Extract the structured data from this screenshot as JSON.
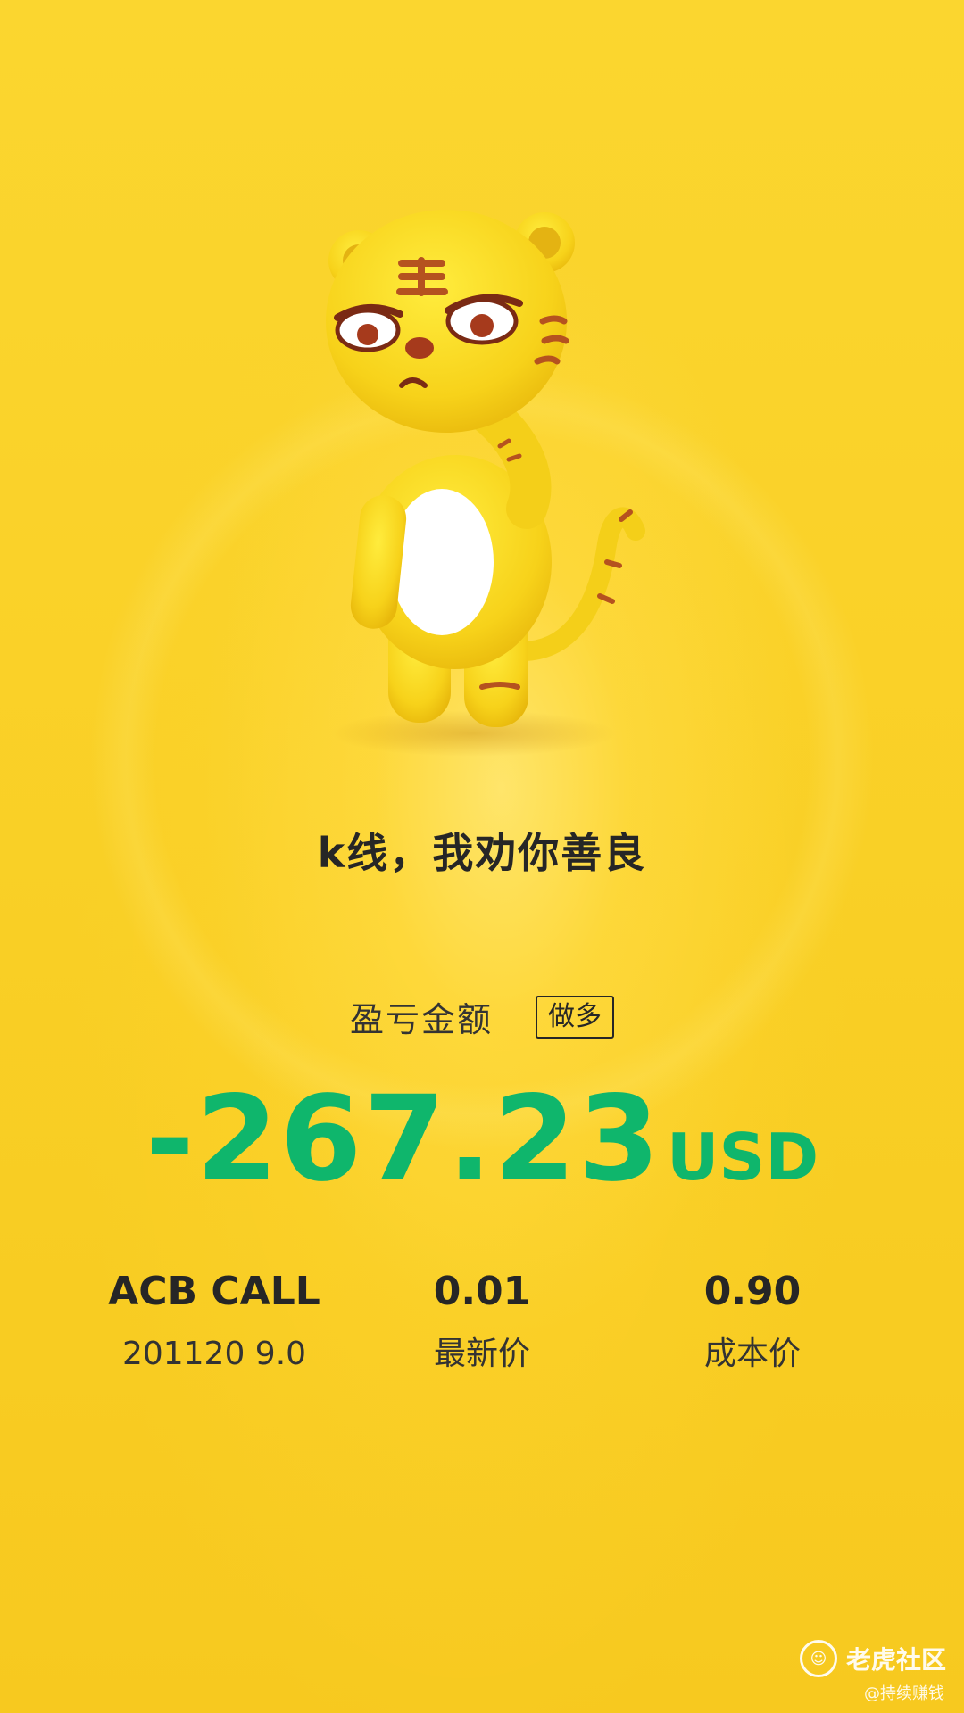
{
  "poster": {
    "headline": "k线，我劝你善良",
    "pnl_label": "盈亏金额",
    "direction_badge": "做多",
    "pnl_amount": "-267.23",
    "pnl_currency": "USD",
    "pnl_color": "#0fb66c"
  },
  "position": {
    "symbol": "ACB CALL",
    "contract": "201120 9.0",
    "latest_price": "0.01",
    "latest_price_label": "最新价",
    "cost_price": "0.90",
    "cost_price_label": "成本价"
  },
  "watermark": {
    "logo_icon": "tiger-logo-icon",
    "brand": "老虎社区",
    "user": "@持续赚钱"
  },
  "colors": {
    "background": "#f9cf25",
    "text": "#262626"
  }
}
